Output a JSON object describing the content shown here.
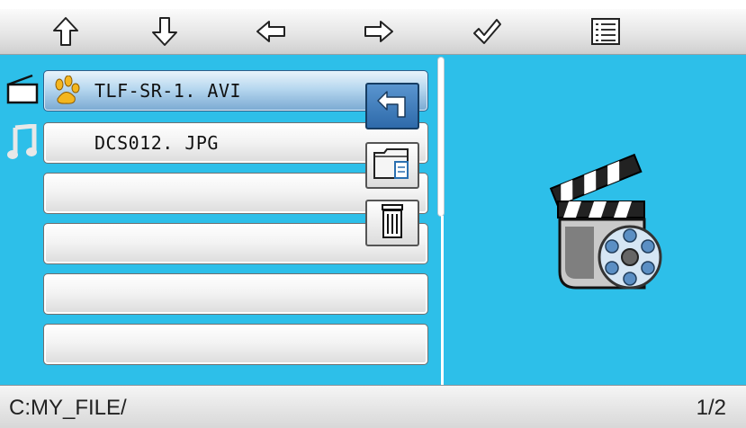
{
  "toolbar": {
    "buttons": [
      "up-arrow-icon",
      "down-arrow-icon",
      "left-arrow-icon",
      "right-arrow-icon",
      "checkmark-icon",
      "list-icon"
    ]
  },
  "categories": [
    "video-category-icon",
    "music-category-icon"
  ],
  "files": [
    {
      "name": "TLF-SR-1. AVI",
      "icon": "paw-icon",
      "selected": true
    },
    {
      "name": "DCS012. JPG",
      "icon": "",
      "selected": false
    },
    {
      "name": "",
      "icon": "",
      "selected": false
    },
    {
      "name": "",
      "icon": "",
      "selected": false
    },
    {
      "name": "",
      "icon": "",
      "selected": false
    },
    {
      "name": "",
      "icon": "",
      "selected": false
    }
  ],
  "actions": [
    "back-icon",
    "folder-copy-icon",
    "trash-icon"
  ],
  "preview_icon": "video-file-icon",
  "status": {
    "path": "C:MY_FILE/",
    "page": "1/2"
  },
  "colors": {
    "background": "#2dbfe9",
    "selected_row": "#7aa9d2",
    "action_button": "#2e6aaa"
  }
}
